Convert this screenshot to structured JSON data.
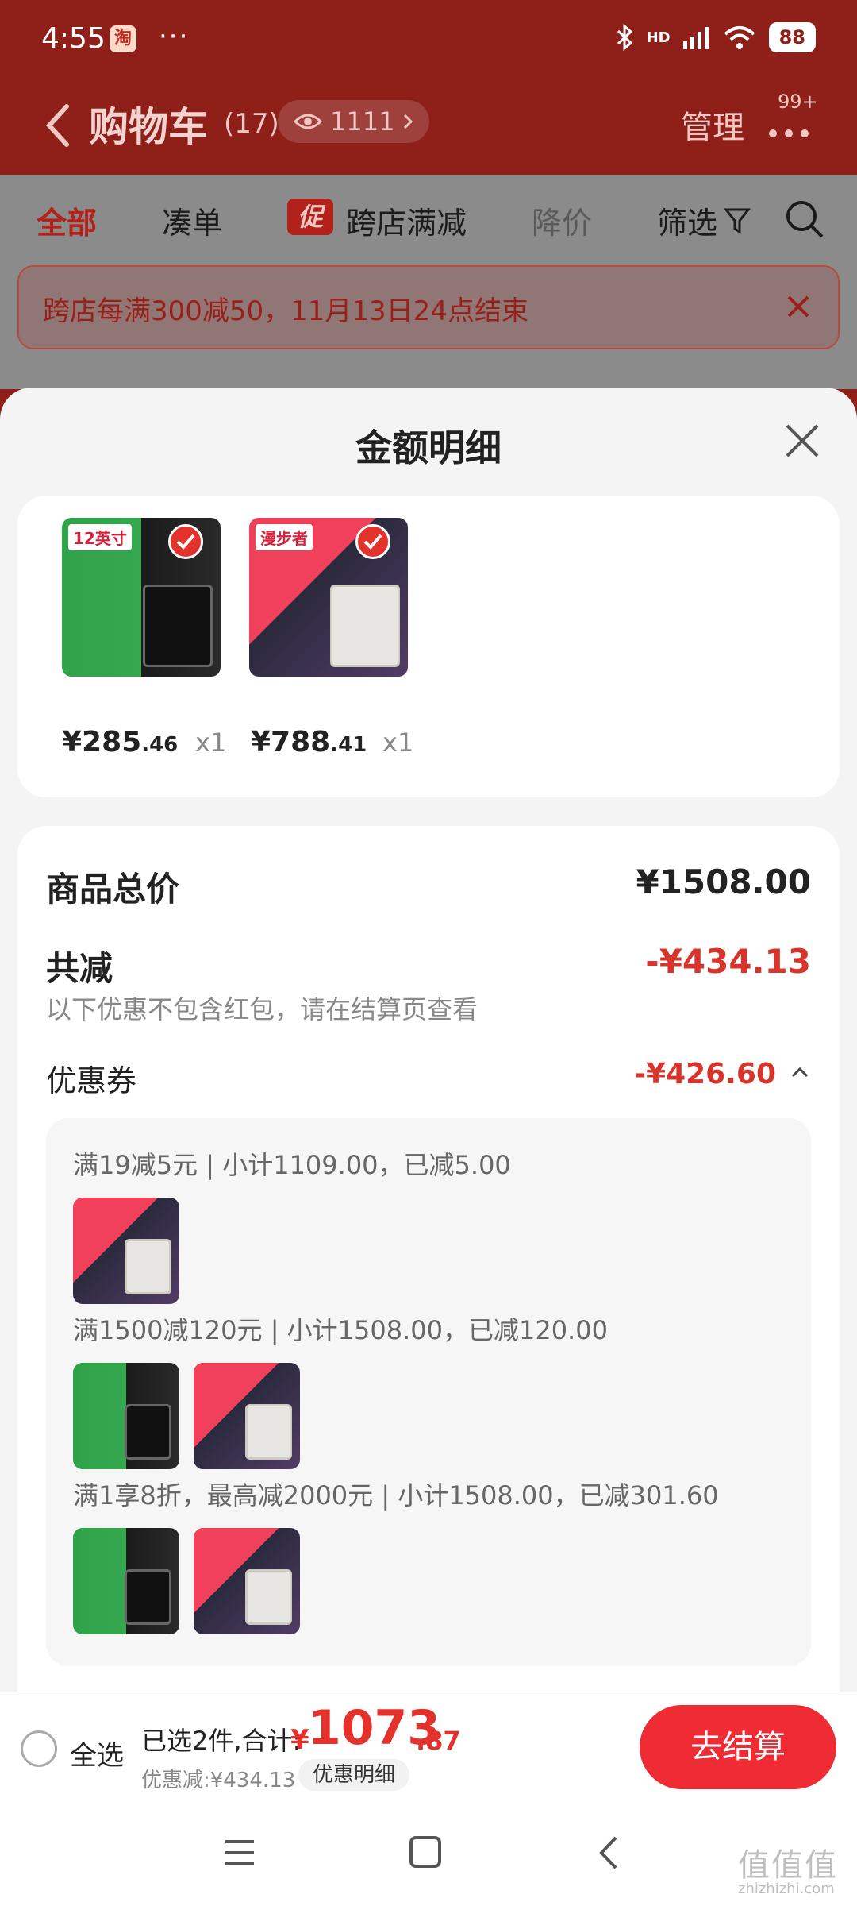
{
  "status_bar": {
    "time": "4:55",
    "app_badge": "淘",
    "dots": "···",
    "network": "HD",
    "battery": "88"
  },
  "header": {
    "title": "购物车",
    "count": "(17)",
    "watch_count": "1111",
    "manage": "管理",
    "badge": "99+"
  },
  "tabs": [
    {
      "label": "全部"
    },
    {
      "label": "凑单"
    },
    {
      "label": "跨店满减",
      "tag": "促"
    },
    {
      "label": "降价"
    },
    {
      "label": "筛选"
    }
  ],
  "promo_banner": {
    "text": "跨店每满300减50，11月13日24点结束"
  },
  "sheet": {
    "title": "金额明细",
    "products": [
      {
        "price_int": "¥285",
        "price_dec": ".46",
        "qty": "x1",
        "thumb_text": "12英寸",
        "selected": true
      },
      {
        "price_int": "¥788",
        "price_dec": ".41",
        "qty": "x1",
        "thumb_text": "漫步者",
        "selected": true
      }
    ],
    "total_label": "商品总价",
    "total_value": "¥1508.00",
    "reduce_label": "共减",
    "reduce_value": "-¥434.13",
    "reduce_note": "以下优惠不包含红包，请在结算页查看",
    "coupon_label": "优惠券",
    "coupon_value": "-¥426.60",
    "coupon_lines": [
      {
        "text": "满19减5元 | 小计1109.00，已减5.00"
      },
      {
        "text": "满1500减120元 | 小计1508.00，已减120.00"
      },
      {
        "text": "满1享8折，最高减2000元 | 小计1508.00，已减301.60"
      }
    ]
  },
  "bottom_bar": {
    "select_all": "全选",
    "summary_label": "已选2件,合计:",
    "summary_yen": "¥",
    "summary_int": "1073",
    "summary_dec": ".87",
    "discount_text": "优惠减:¥434.13",
    "detail_pill": "优惠明细",
    "checkout": "去结算"
  },
  "watermark": {
    "main": "值值值",
    "sub": "zhizhizhi.com"
  },
  "colors": {
    "brand_red": "#e3312b",
    "header_red": "#8e1f19",
    "price_red": "#d8342c"
  }
}
